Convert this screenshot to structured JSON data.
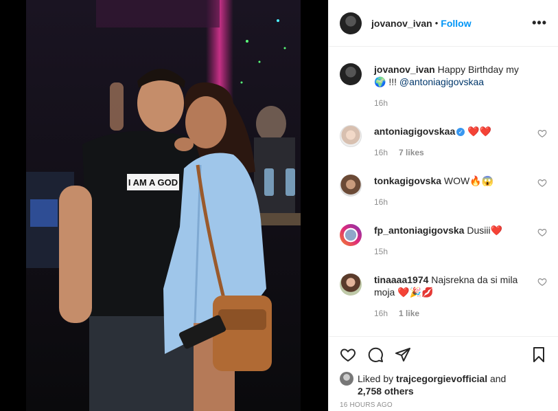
{
  "header": {
    "username": "jovanov_ivan",
    "separator": "•",
    "follow_label": "Follow",
    "more_icon": "more-horizontal-icon"
  },
  "caption": {
    "username": "jovanov_ivan",
    "text": "Happy Birthday my 🌍 !!!",
    "mention": "@antoniagigovskaa",
    "time": "16h"
  },
  "comments": [
    {
      "username": "antoniagigovskaa",
      "verified": true,
      "text": "❤️❤️",
      "time": "16h",
      "likes": "7 likes"
    },
    {
      "username": "tonkagigovska",
      "verified": false,
      "text": "WOW🔥😱",
      "time": "16h",
      "likes": ""
    },
    {
      "username": "fp_antoniagigovska",
      "verified": false,
      "text": "Dusiii❤️",
      "time": "15h",
      "likes": ""
    },
    {
      "username": "tinaaaa1974",
      "verified": false,
      "text": "Najsrekna da si mila moja ❤️🎉💋",
      "time": "16h",
      "likes": "1 like"
    }
  ],
  "actions": {
    "liked_prefix": "Liked by",
    "liked_user": "trajcegorgievofficial",
    "liked_and": "and",
    "liked_others": "2,758 others",
    "timestamp": "16 HOURS AGO"
  },
  "photo": {
    "shirt_text": "I AM A GOD"
  }
}
